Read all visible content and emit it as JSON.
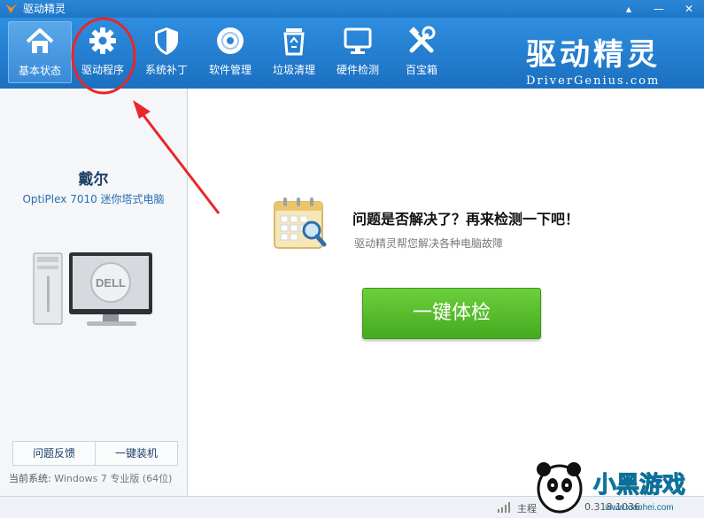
{
  "window": {
    "title": "驱动精灵",
    "controls": [
      {
        "name": "skin-icon",
        "glyph": "▲"
      },
      {
        "name": "minimize-icon",
        "glyph": "—"
      },
      {
        "name": "close-icon",
        "glyph": "✕"
      }
    ]
  },
  "toolbar": {
    "items": [
      {
        "label": "基本状态",
        "icon": "home-icon"
      },
      {
        "label": "驱动程序",
        "icon": "gear-icon"
      },
      {
        "label": "系统补丁",
        "icon": "shield-icon"
      },
      {
        "label": "软件管理",
        "icon": "disc-icon"
      },
      {
        "label": "垃圾清理",
        "icon": "recycle-bin-icon"
      },
      {
        "label": "硬件检测",
        "icon": "monitor-icon"
      },
      {
        "label": "百宝箱",
        "icon": "tools-icon"
      }
    ],
    "active_index": 0,
    "brand_cn": "驱动精灵",
    "brand_en": "DriverGenius.com"
  },
  "sidebar": {
    "brand": "戴尔",
    "model": "OptiPlex 7010 迷你塔式电脑",
    "computer_logo": "DELL",
    "buttons": [
      "问题反馈",
      "一键装机"
    ],
    "system_label": "当前系统:",
    "system_value": "Windows 7 专业版 (64位)"
  },
  "main": {
    "headline": "问题是否解决了？再来检测一下吧！",
    "subline": "驱动精灵帮您解决各种电脑故障",
    "action_button": "一键体检"
  },
  "statusbar": {
    "label": "主程",
    "version": "0.318.1036"
  },
  "watermark": {
    "text": "小黑游戏",
    "url": "www.xiaohei.com"
  },
  "colors": {
    "titlebar": "#1f76c6",
    "toolbar": "#2f8ee0",
    "accent_green": "#45aa1f",
    "annotation_red": "#e8262b"
  }
}
